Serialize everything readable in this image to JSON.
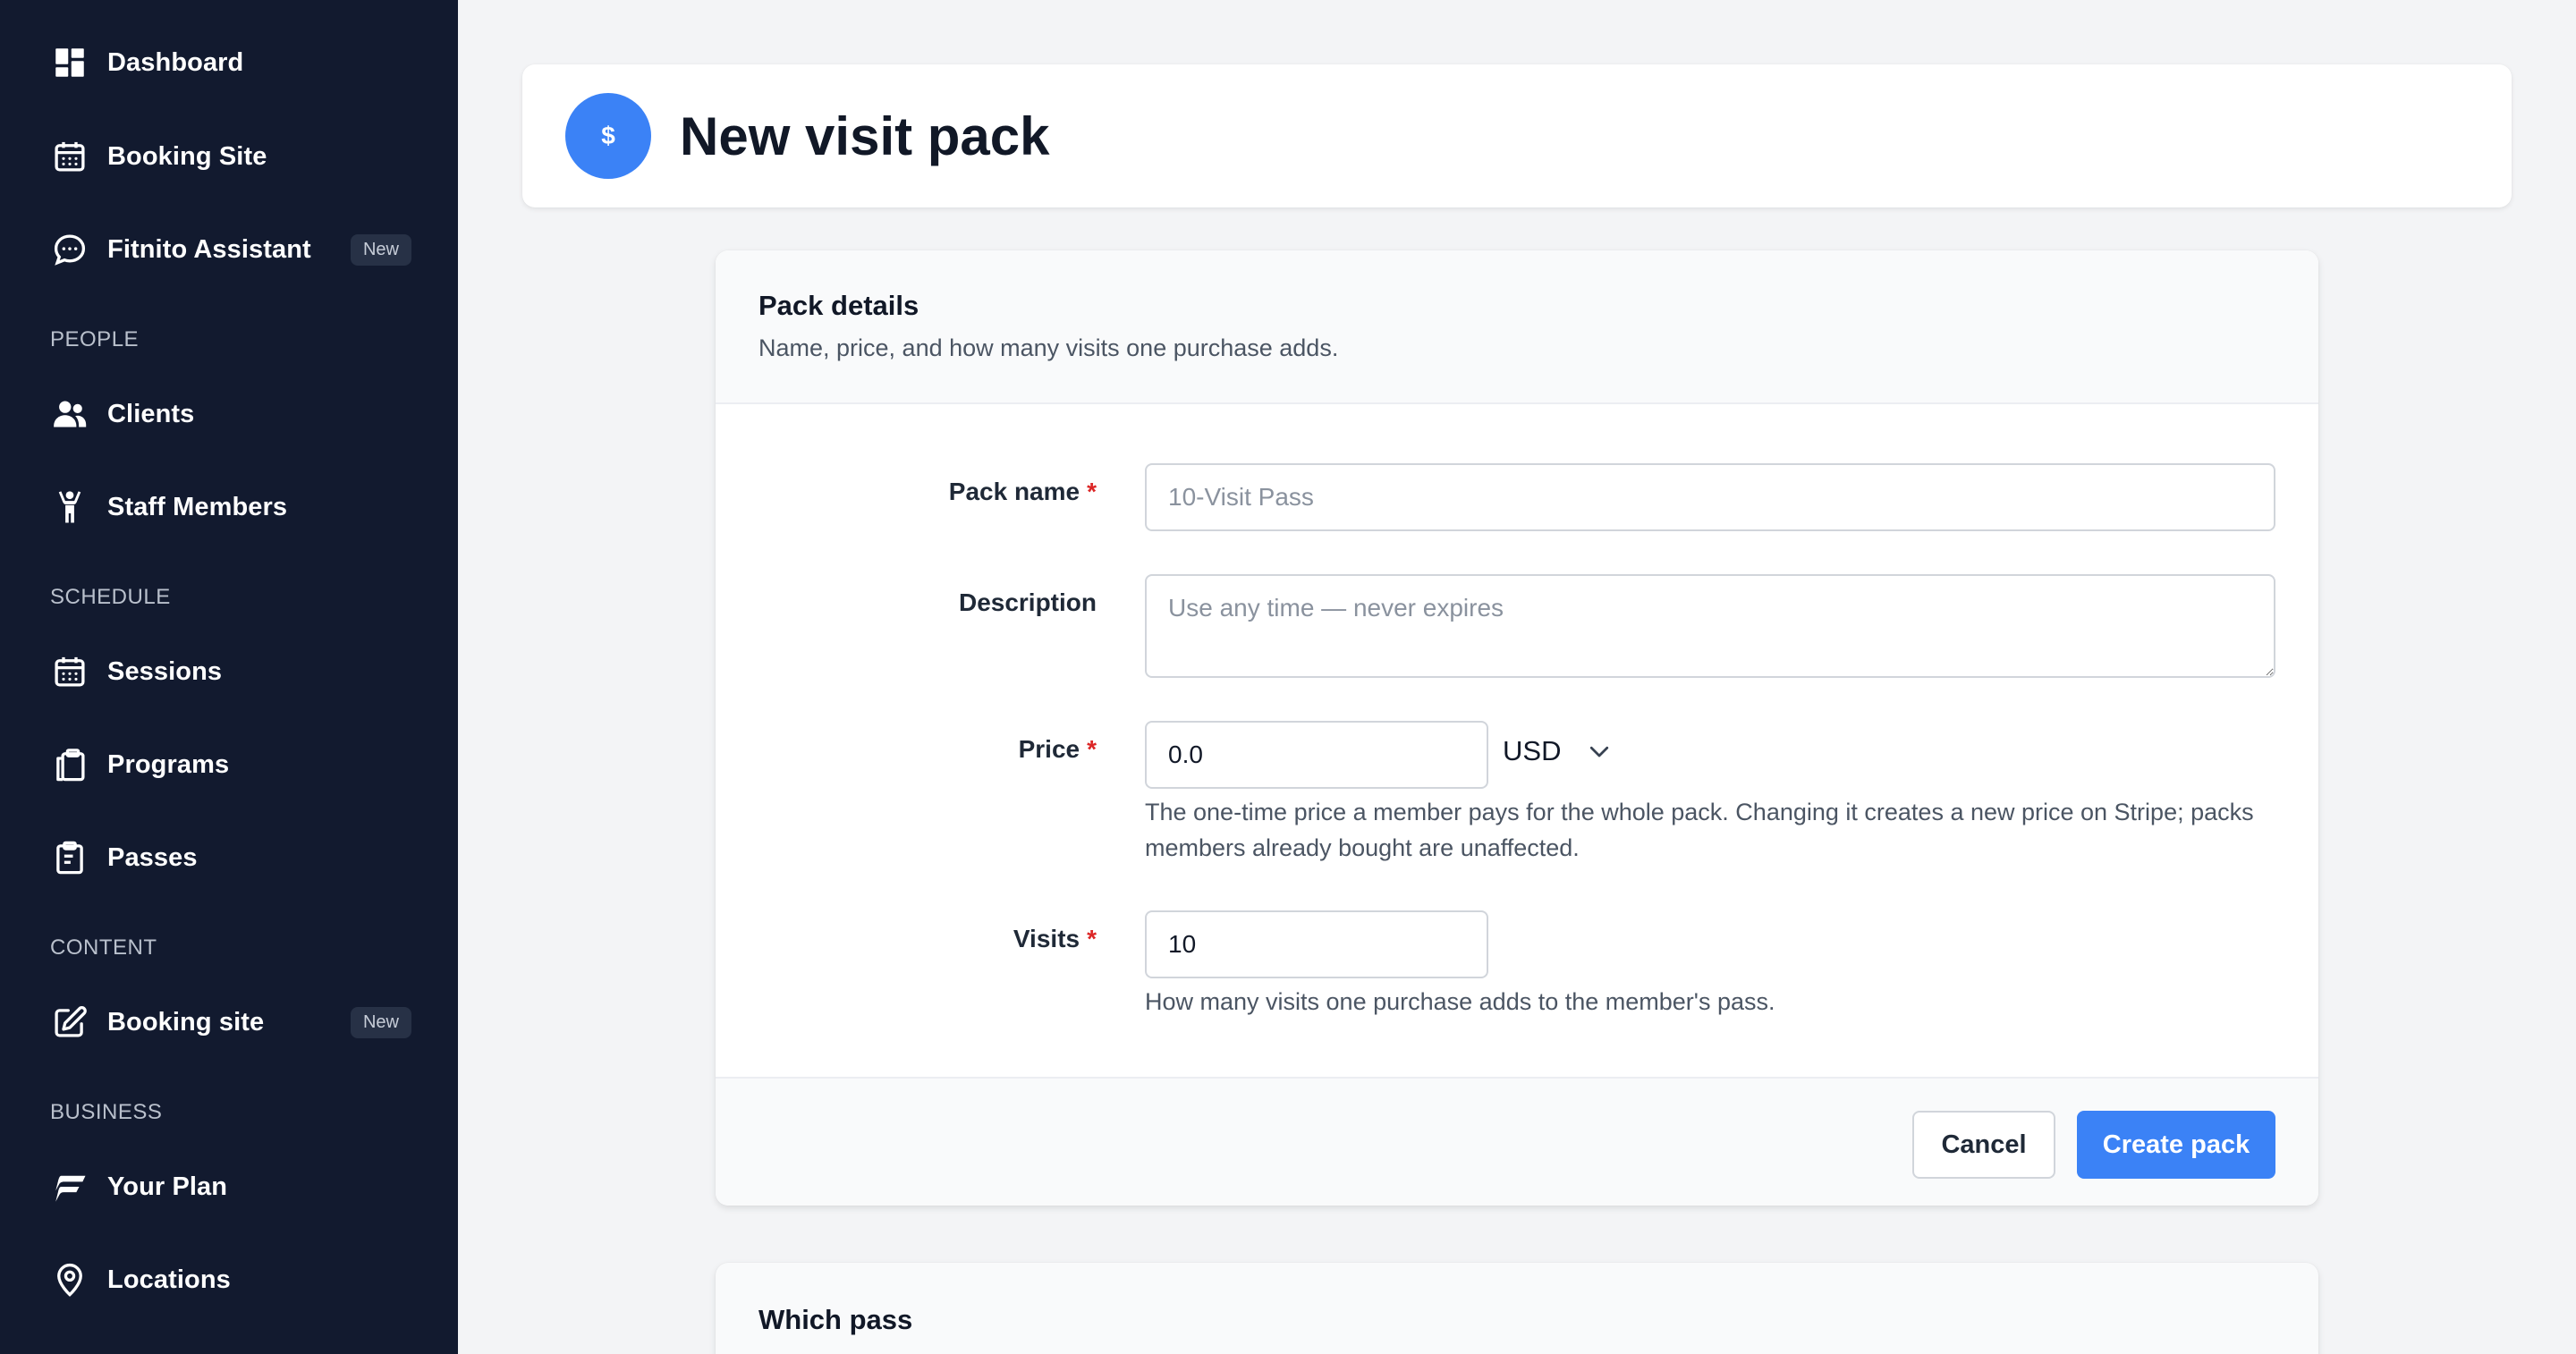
{
  "sidebar": {
    "items": [
      {
        "label": "Dashboard",
        "icon": "dashboard-icon"
      },
      {
        "label": "Booking Site",
        "icon": "calendar-icon"
      },
      {
        "label": "Fitnito Assistant",
        "icon": "chat-bubble-icon",
        "badge": "New"
      },
      {
        "label": "Clients",
        "icon": "users-icon"
      },
      {
        "label": "Staff Members",
        "icon": "person-icon"
      },
      {
        "label": "Sessions",
        "icon": "calendar-icon"
      },
      {
        "label": "Programs",
        "icon": "clipboard-copy-icon"
      },
      {
        "label": "Passes",
        "icon": "clipboard-list-icon"
      },
      {
        "label": "Booking site",
        "icon": "edit-icon",
        "badge": "New"
      },
      {
        "label": "Your Plan",
        "icon": "fitnito-logo-icon"
      },
      {
        "label": "Locations",
        "icon": "map-pin-icon"
      }
    ],
    "sections": {
      "people": "PEOPLE",
      "schedule": "SCHEDULE",
      "content": "CONTENT",
      "business": "BUSINESS"
    }
  },
  "header": {
    "icon_symbol": "$",
    "title": "New visit pack"
  },
  "form": {
    "title": "Pack details",
    "subtitle": "Name, price, and how many visits one purchase adds.",
    "pack_name": {
      "label": "Pack name",
      "required_mark": "*",
      "value": "",
      "placeholder": "10-Visit Pass"
    },
    "description": {
      "label": "Description",
      "value": "",
      "placeholder": "Use any time — never expires"
    },
    "price": {
      "label": "Price",
      "required_mark": "*",
      "value": "0.0",
      "currency": "USD",
      "help": "The one-time price a member pays for the whole pack. Changing it creates a new price on Stripe; packs members already bought are unaffected."
    },
    "visits": {
      "label": "Visits",
      "required_mark": "*",
      "value": "10",
      "help": "How many visits one purchase adds to the member's pass."
    },
    "cancel_label": "Cancel",
    "create_label": "Create pack"
  },
  "second_card": {
    "title": "Which pass"
  },
  "colors": {
    "sidebar_bg": "#121a2f",
    "accent": "#3b82f6",
    "required": "#dc2626",
    "page_bg": "#f3f4f6"
  }
}
